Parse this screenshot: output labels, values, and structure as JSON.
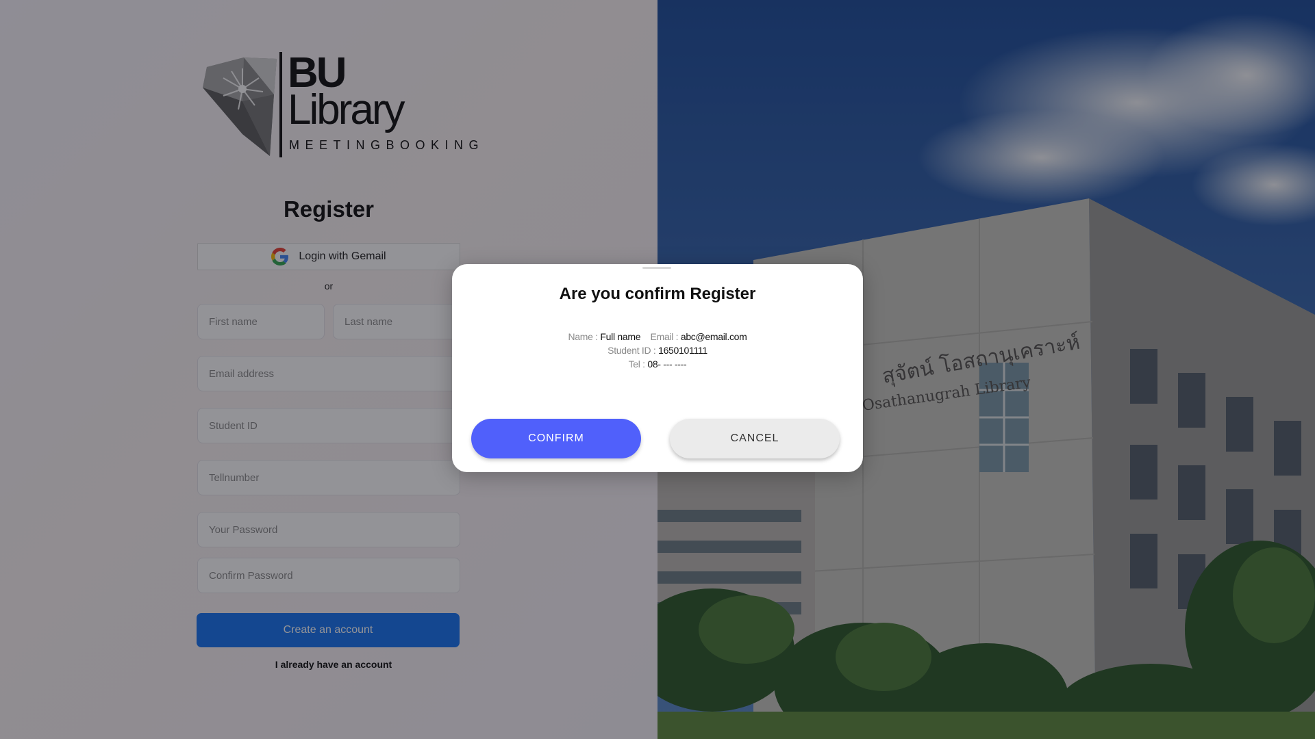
{
  "logo": {
    "line1": "BU",
    "line2": "Library",
    "tagline": "MEETINGBOOKING"
  },
  "register": {
    "title": "Register",
    "gmail_label": "Login with Gemail",
    "or": "or",
    "fields": {
      "first_name": "First name",
      "last_name": "Last name",
      "email": "Email address",
      "student_id": "Student ID",
      "tel": "Tellnumber",
      "password": "Your Password",
      "confirm_password": "Confirm Password"
    },
    "create_label": "Create an account",
    "already_label": "I already have an account"
  },
  "background": {
    "sign_thai": "สุจัตน์ โอสถานุเคราะห์",
    "sign_en": "Osathanugrah Library"
  },
  "modal": {
    "title": "Are you confirm Register",
    "name_key": "Name : ",
    "name_value": "Full name",
    "email_key": "Email : ",
    "email_value": "abc@email.com",
    "sid_key": "Student ID : ",
    "sid_value": "1650101111",
    "tel_key": "Tel : ",
    "tel_value": "08- --- ----",
    "confirm_label": "CONFIRM",
    "cancel_label": "CANCEL"
  },
  "colors": {
    "primary_blue": "#1976f2",
    "confirm_blue": "#5060fb",
    "cancel_gray": "#ebebeb"
  }
}
